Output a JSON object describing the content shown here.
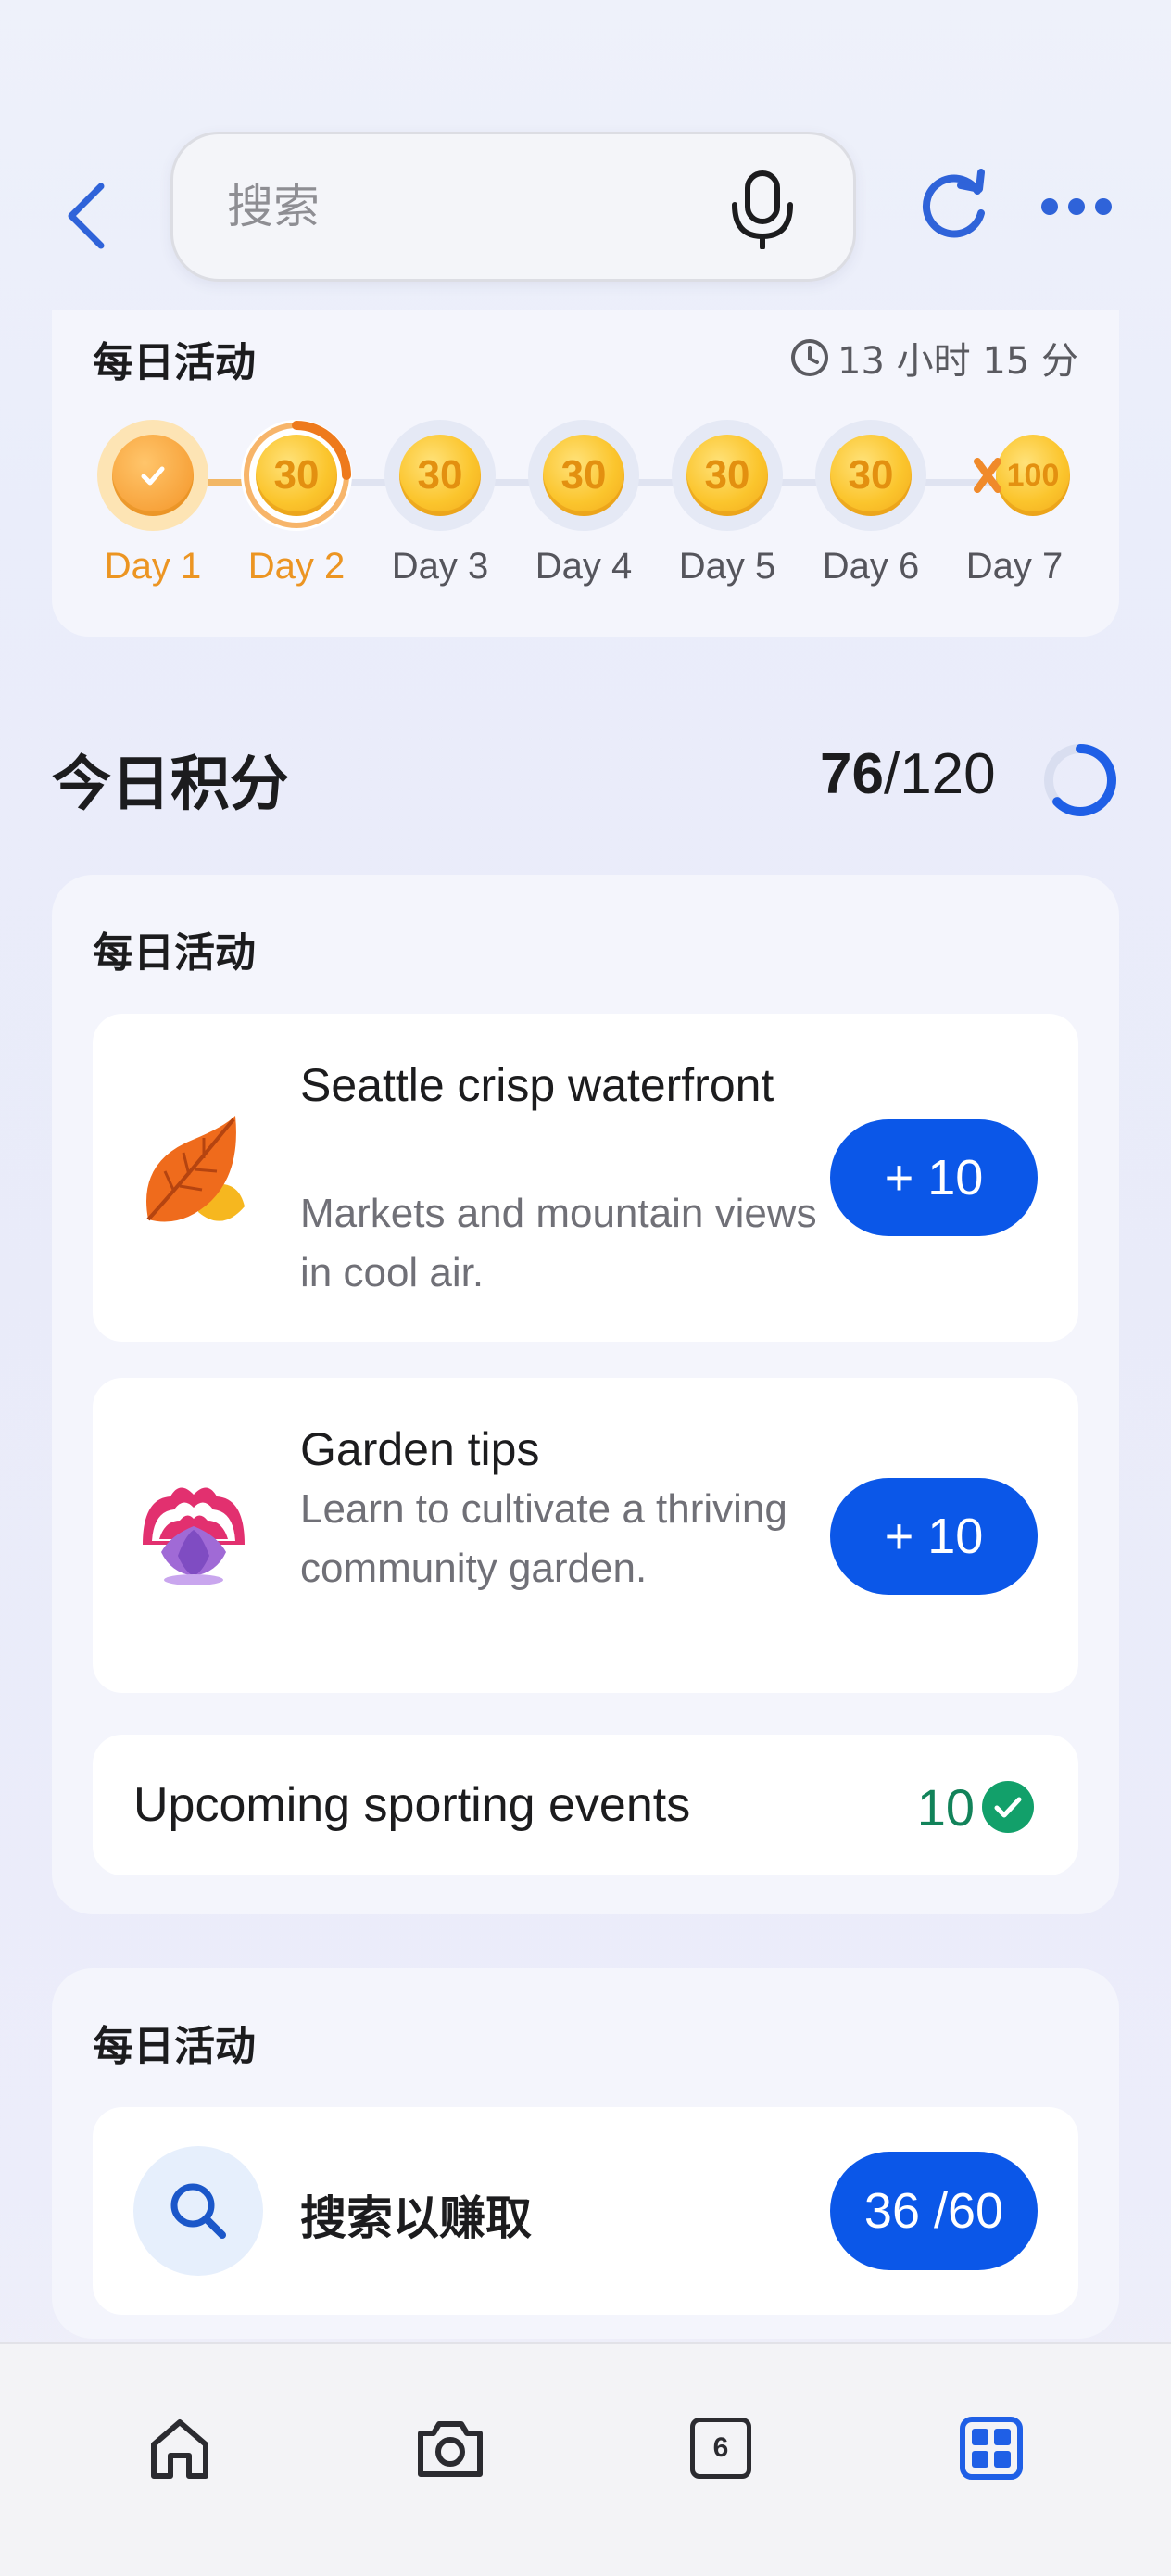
{
  "header": {
    "search_placeholder": "搜索",
    "icons": {
      "back": "back-arrow-icon",
      "mic": "microphone-icon",
      "refresh": "refresh-icon",
      "more": "more-icon"
    }
  },
  "streak": {
    "title": "每日活动",
    "timer": "13 小时 15 分",
    "days": [
      {
        "label": "Day 1",
        "coin": "",
        "state": "completed"
      },
      {
        "label": "Day 2",
        "coin": "30",
        "state": "current"
      },
      {
        "label": "Day 3",
        "coin": "30",
        "state": "upcoming"
      },
      {
        "label": "Day 4",
        "coin": "30",
        "state": "upcoming"
      },
      {
        "label": "Day 5",
        "coin": "30",
        "state": "upcoming"
      },
      {
        "label": "Day 6",
        "coin": "30",
        "state": "upcoming"
      },
      {
        "label": "Day 7",
        "coin": "100",
        "state": "bonus"
      }
    ]
  },
  "points": {
    "title": "今日积分",
    "current": "76",
    "total": "/120",
    "progress": 0.63
  },
  "daily_activities": {
    "title": "每日活动",
    "items": [
      {
        "title": "Seattle crisp waterfront",
        "subtitle": "Markets and mountain views in cool air.",
        "reward": "+ 10",
        "icon": "autumn-leaf-icon"
      },
      {
        "title": "Garden tips",
        "subtitle": "Learn to cultivate a thriving community garden.",
        "reward": "+ 10",
        "icon": "lotus-flower-icon"
      }
    ],
    "completed": {
      "title": "Upcoming sporting events",
      "points": "10"
    }
  },
  "search_activity": {
    "title": "每日活动",
    "label": "搜索以赚取",
    "progress_text": "36 /60"
  },
  "bottom_nav": {
    "items": [
      {
        "name": "home",
        "icon": "home-icon"
      },
      {
        "name": "camera",
        "icon": "camera-icon"
      },
      {
        "name": "tabs",
        "icon": "tabs-icon",
        "count": "6"
      },
      {
        "name": "apps",
        "icon": "apps-grid-icon",
        "active": true
      }
    ]
  },
  "colors": {
    "accent": "#0b57e8",
    "gold": "#f2a71a",
    "active_day": "#ec9522",
    "success": "#12835a"
  }
}
